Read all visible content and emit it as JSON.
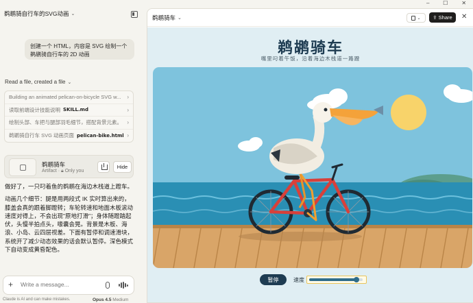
{
  "chat": {
    "title": "鹈鹕骑自行车的SVG动画",
    "user_message": "创建一个 HTML，内容是 SVG 绘制一个鹈鹕骑自行车的 2D 动画",
    "read_line": "Read a file, created a file",
    "steps": [
      {
        "text": "Building an animated pelican-on-bicycle SVG w...",
        "file": ""
      },
      {
        "text": "读取前端设计技能说明",
        "file": "SKILL.md"
      },
      {
        "text": "绘制头部、车把与腿部羽毛细节，搭配背景元素。",
        "file": ""
      },
      {
        "text": "鹈鹕骑自行车 SVG 动画页面",
        "file": "pelican-bike.html"
      }
    ],
    "artifact": {
      "name": "鹈鹕骑车",
      "type": "Artifact",
      "visibility": "Only you",
      "hide_label": "Hide"
    },
    "reply": [
      "做好了，一只叼着鱼的鹈鹕在海边木栈道上蹬车。",
      "动画几个细节：腿是用两段式 IK 实时算出来的，膝盖会真的跟着脚蹬转；车轮转速和地面木板滚动速度对得上，不会出现\"原地打滑\"；身体随蹬踏起伏，头慢半拍点头，喙囊会晃。背景是木板、海浪、小岛、云四层视差。下面有暂停和调速滑块，系统开了减少动态效果的话会默认暂停。深色模式下自动变成黄昏配色。"
    ],
    "composer_placeholder": "Write a message...",
    "disclaimer": "Claude is AI and can make mistakes.",
    "model": "Opus 4.5",
    "model_effort": "Medium"
  },
  "artifact_panel": {
    "title": "鹈鹕骑车",
    "copy_label": "",
    "share_label": "Share",
    "page": {
      "heading": "鹈鹕骑车",
      "subheading": "嘴里叼着午饭，沿着海边木栈道一路蹬",
      "pause_label": "暂停",
      "speed_label": "速度",
      "speed_value": 0.88
    }
  },
  "colors": {
    "sky": "#7ec3dd",
    "sea": "#2a8fb4",
    "boardwalk": "#d9a568",
    "sun": "#f8d36a",
    "bike_frame": "#d8403a",
    "beak": "#f4a23a",
    "dark_navy": "#1e3c52"
  }
}
